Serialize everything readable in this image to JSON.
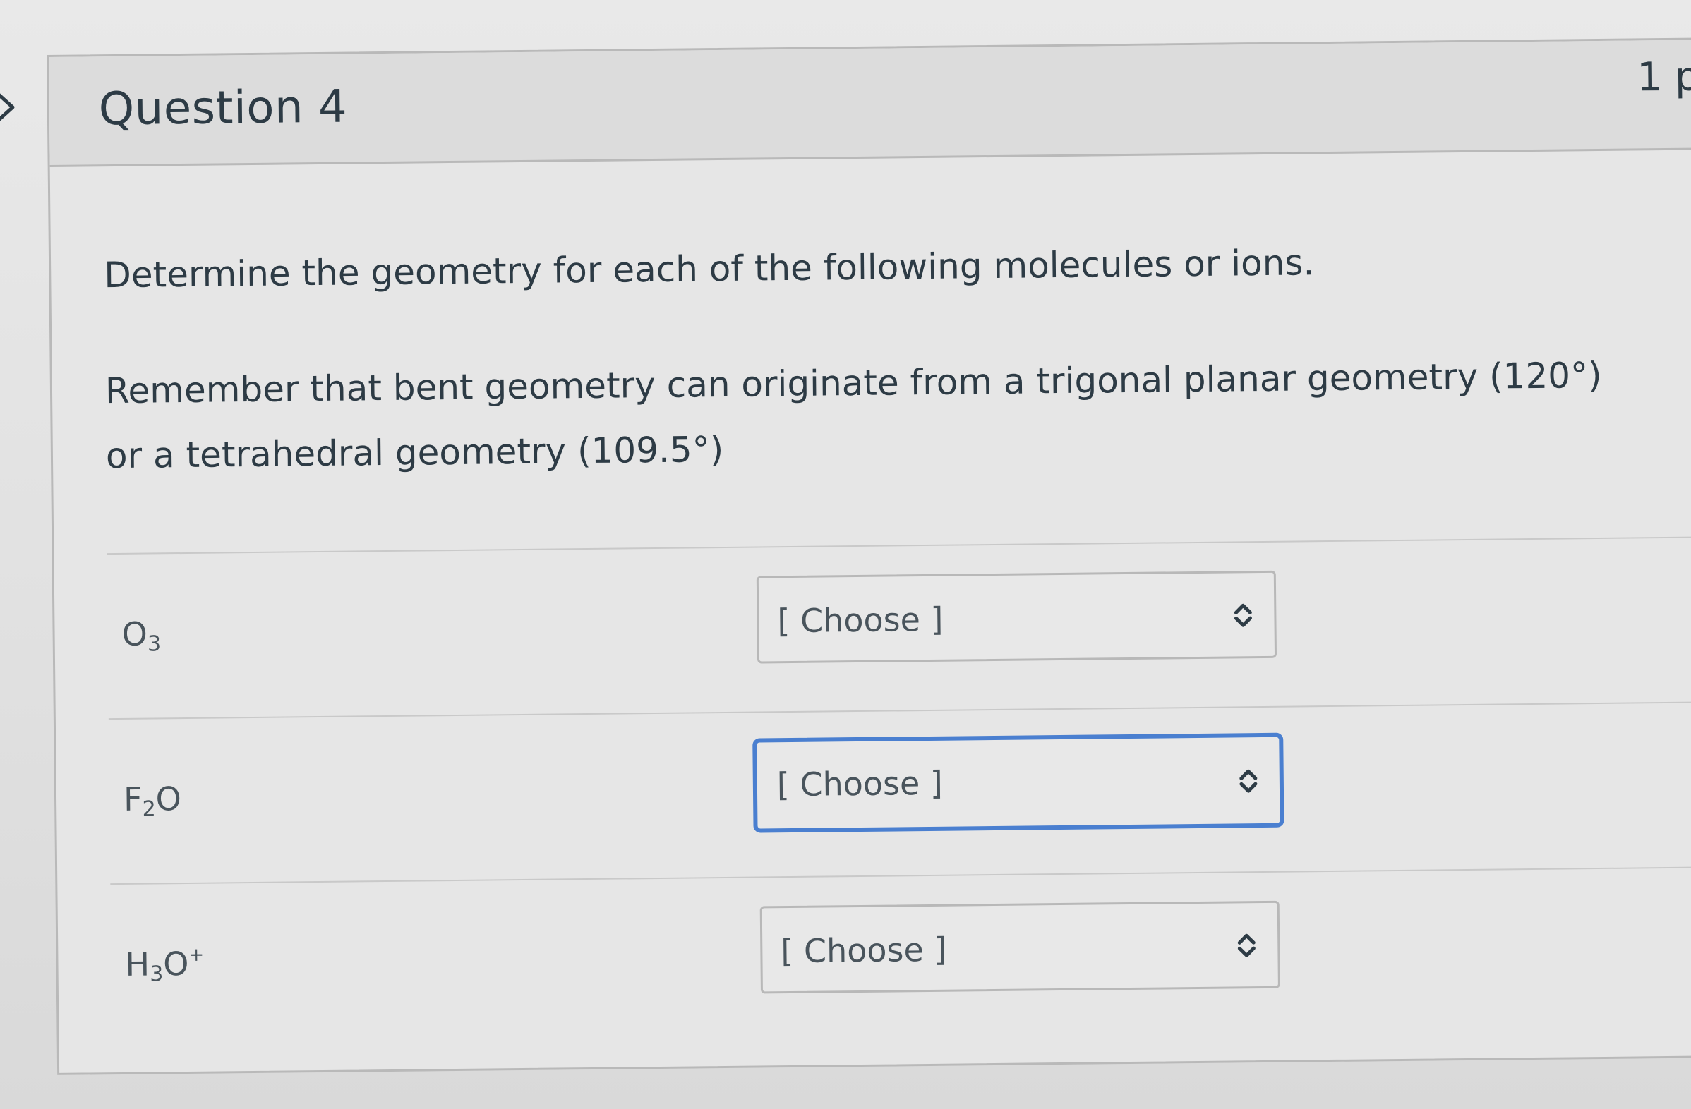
{
  "question": {
    "title": "Question 4",
    "points": "1 p"
  },
  "prompt": {
    "line1": "Determine the geometry for each of the following molecules or ions.",
    "line2": "Remember that bent geometry can originate from a trigonal planar geometry (120°) or a tetrahedral geometry (109.5°)"
  },
  "rows": [
    {
      "label_main": "O",
      "label_sub": "3",
      "label_rest": "",
      "label_sup": "",
      "select_value": "[ Choose ]",
      "focused": false
    },
    {
      "label_main": "F",
      "label_sub": "2",
      "label_rest": "O",
      "label_sup": "",
      "select_value": "[ Choose ]",
      "focused": true
    },
    {
      "label_main": "H",
      "label_sub": "3",
      "label_rest": "O",
      "label_sup": "+",
      "select_value": "[ Choose ]",
      "focused": false
    }
  ],
  "icons": {
    "nav": "chevron-right-icon",
    "select": "up-down-arrows-icon"
  },
  "colors": {
    "text": "#2d3b45",
    "focus_border": "#4a7fd0",
    "border": "#b9b9b9"
  }
}
